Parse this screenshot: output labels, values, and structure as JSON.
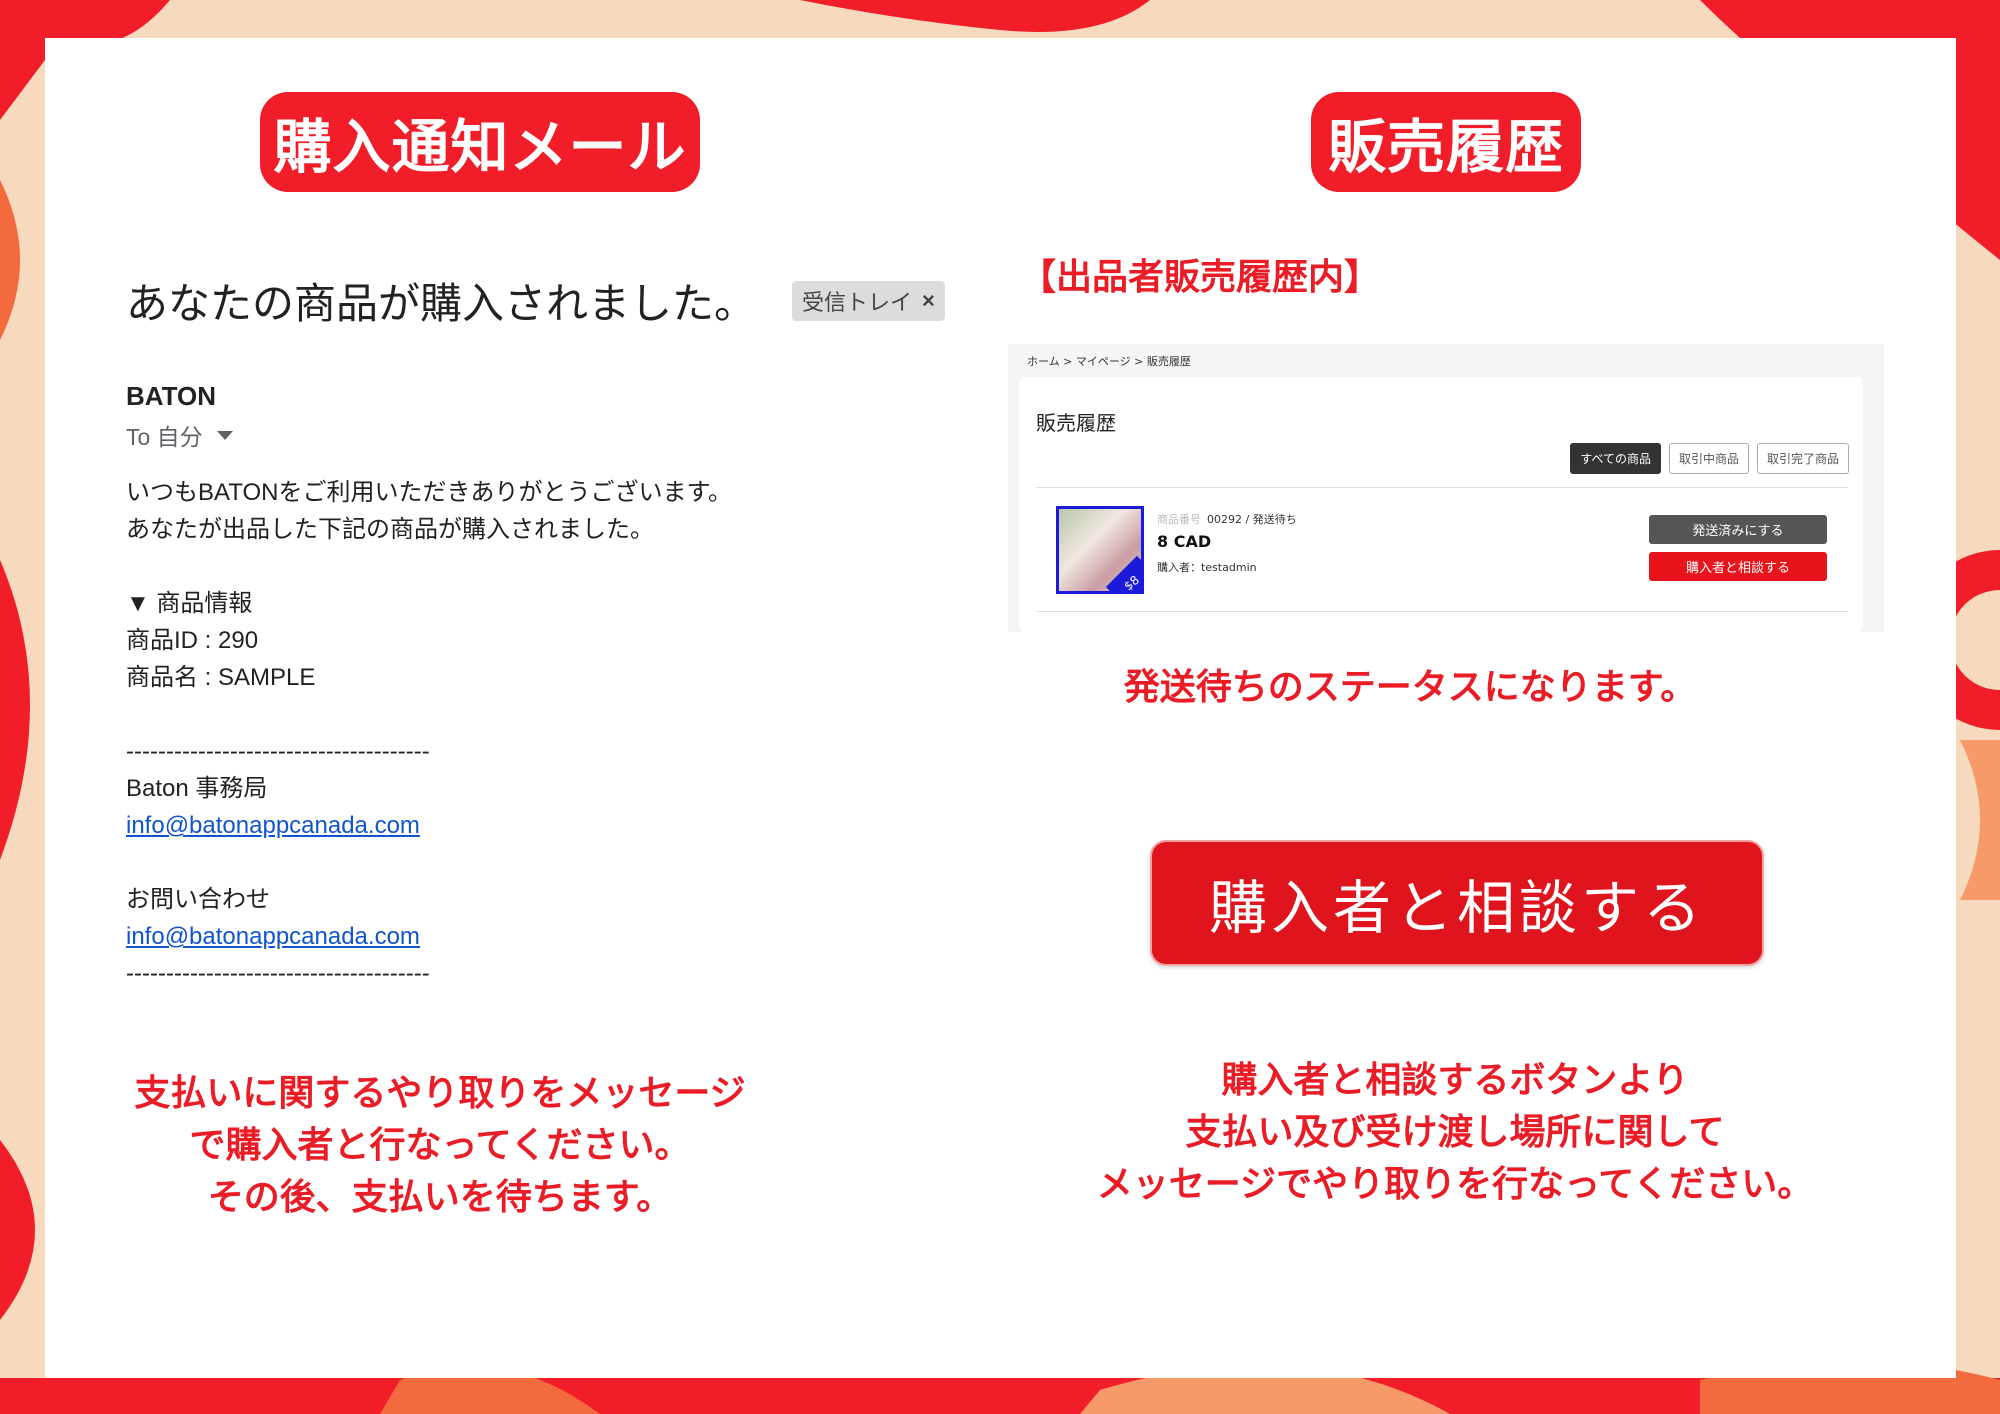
{
  "colors": {
    "accent": "#f11d28",
    "link": "#1155cc"
  },
  "left": {
    "heading": "購入通知メール",
    "email": {
      "subject": "あなたの商品が購入されました。",
      "inbox_label": "受信トレイ",
      "sender": "BATON",
      "to": "To 自分",
      "lines": [
        "いつもBATONをご利用いただきありがとうございます。",
        "あなたが出品した下記の商品が購入されました。",
        "",
        "▼ 商品情報",
        "商品ID : 290",
        "商品名 : SAMPLE",
        "",
        "--------------------------------------",
        "Baton 事務局"
      ],
      "link1": "info@batonappcanada.com",
      "contact_label": "お問い合わせ",
      "link2": "info@batonappcanada.com",
      "separator": "--------------------------------------"
    },
    "note": [
      "支払いに関するやり取りをメッセージ",
      "で購入者と行なってください。",
      "その後、支払いを待ちます。"
    ]
  },
  "right": {
    "heading": "販売履歴",
    "section_label": "【出品者販売履歴内】",
    "screenshot": {
      "breadcrumb": "ホーム > マイページ > 販売履歴",
      "title": "販売履歴",
      "tabs": [
        "すべての商品",
        "取引中商品",
        "取引完了商品"
      ],
      "item": {
        "id_label": "商品番号",
        "id_status": "00292 / 発送待ち",
        "price": "8 CAD",
        "buyer": "購入者：testadmin",
        "thumb_tag": "$8"
      },
      "btn_shipped": "発送済みにする",
      "btn_consult": "購入者と相談する"
    },
    "status_note": "発送待ちのステータスになります。",
    "big_button": "購入者と相談する",
    "note": [
      "購入者と相談するボタンより",
      "支払い及び受け渡し場所に関して",
      "メッセージでやり取りを行なってください。"
    ]
  }
}
